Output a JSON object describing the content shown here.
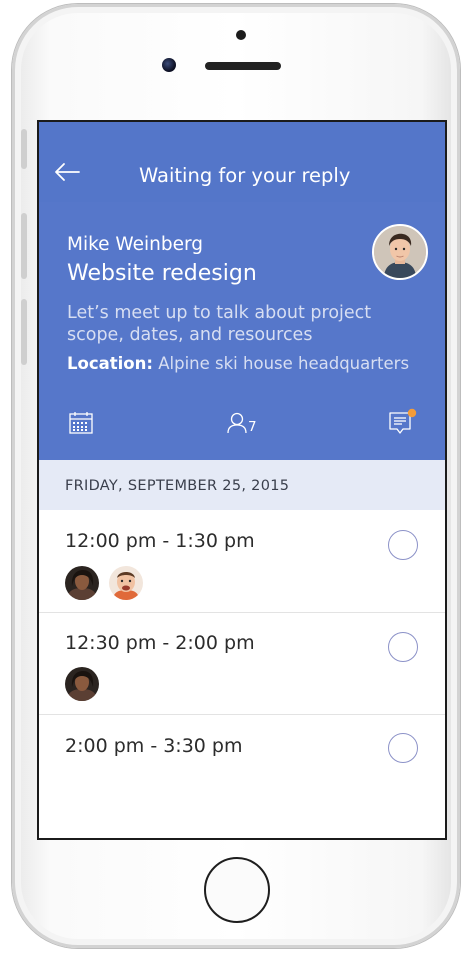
{
  "header": {
    "title": "Waiting for your reply",
    "organizer": "Mike Weinberg",
    "subject": "Website redesign",
    "description": "Let’s meet up to talk about project scope, dates, and resources",
    "location_label": "Location:",
    "location_value": "Alpine ski house headquarters",
    "attendee_count": "7",
    "icons": [
      "back-arrow-icon",
      "calendar-icon",
      "people-icon",
      "notes-icon"
    ]
  },
  "date_label": "FRIDAY, SEPTEMBER 25, 2015",
  "slots": [
    {
      "time": "12:00 pm - 1:30 pm"
    },
    {
      "time": "12:30 pm - 2:00 pm"
    },
    {
      "time": "2:00 pm - 3:30 pm"
    }
  ],
  "colors": {
    "header_blue": "#5677ca",
    "date_bar": "#e5eaf6",
    "notification_dot": "#f39c3a",
    "radio_outline": "#8c92c8"
  }
}
